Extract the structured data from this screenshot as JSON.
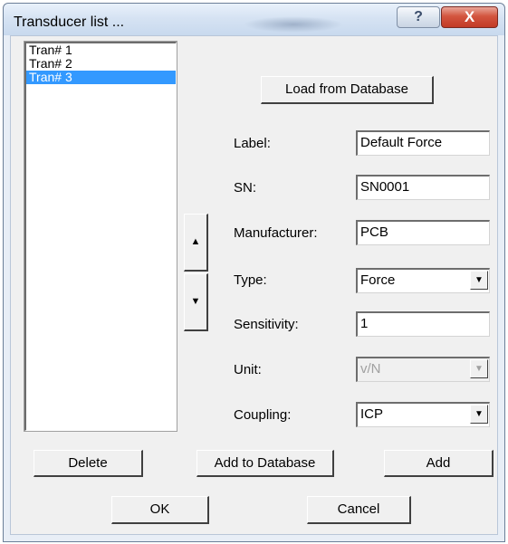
{
  "window": {
    "title": "Transducer list ...",
    "help_icon": "question-icon",
    "close_icon": "close-icon",
    "help_glyph": "?",
    "close_glyph": "X"
  },
  "transducers": [
    "Tran# 1",
    "Tran# 2",
    "Tran# 3"
  ],
  "selected_index": 2,
  "buttons": {
    "load_from_database": "Load from Database",
    "move_up": "▲",
    "move_down": "▼",
    "delete": "Delete",
    "add_to_database": "Add to Database",
    "add": "Add",
    "ok": "OK",
    "cancel": "Cancel"
  },
  "form": {
    "label": {
      "caption": "Label:",
      "value": "Default Force"
    },
    "sn": {
      "caption": "SN:",
      "value": "SN0001"
    },
    "manufacturer": {
      "caption": "Manufacturer:",
      "value": "PCB"
    },
    "type": {
      "caption": "Type:",
      "value": "Force"
    },
    "sensitivity": {
      "caption": "Sensitivity:",
      "value": "1"
    },
    "unit": {
      "caption": "Unit:",
      "value": "v/N",
      "disabled": true
    },
    "coupling": {
      "caption": "Coupling:",
      "value": "ICP"
    }
  },
  "colors": {
    "selection": "#3399ff",
    "dialog_bg": "#f0f0f0",
    "titlebar": "#d6e3f3",
    "close_button": "#c23a26"
  }
}
